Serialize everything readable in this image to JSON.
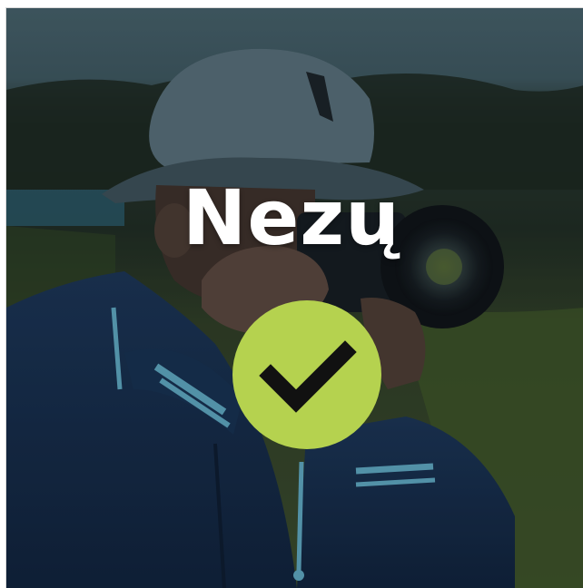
{
  "card": {
    "title": "Nezų",
    "photo_subject": "photographer-image"
  },
  "verify_button": {
    "icon": "checkmark-icon",
    "color": "#b5d24f"
  },
  "colors": {
    "overlay_sky": "#3c5963",
    "overlay_ground": "#36482a",
    "jacket": "#152a48",
    "jacket_stripe": "#5fa7c0"
  }
}
